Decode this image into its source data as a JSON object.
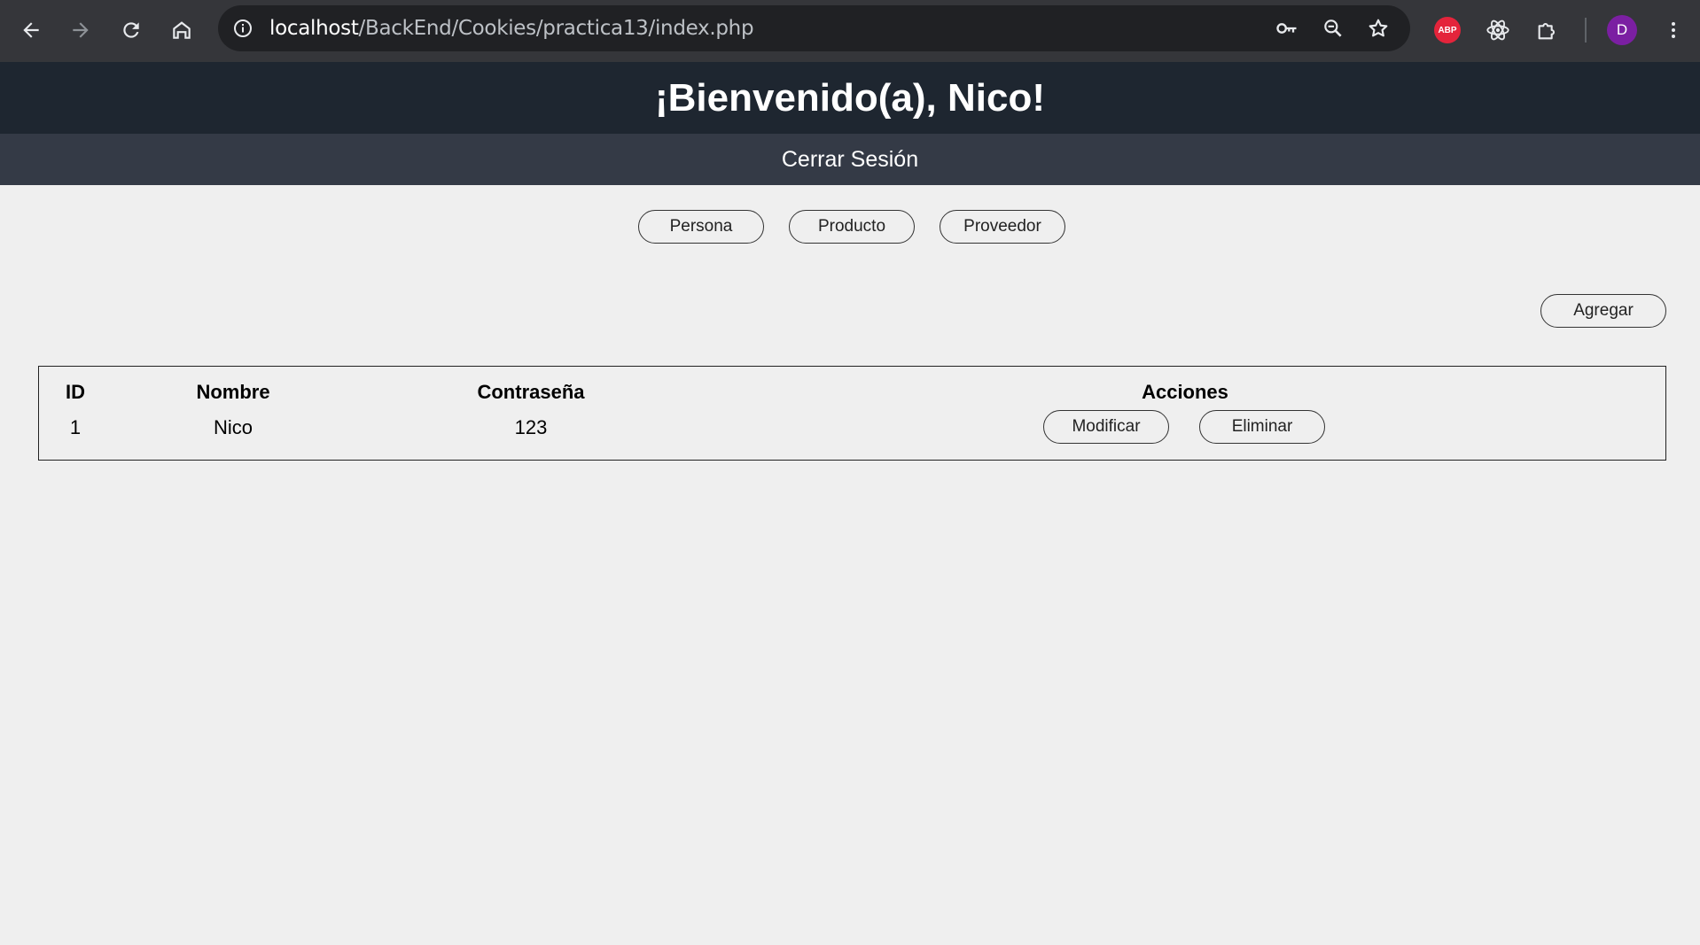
{
  "browser": {
    "url_host": "localhost",
    "url_path": "/BackEnd/Cookies/practica13/index.php",
    "icons": {
      "back": "arrow-left-icon",
      "forward": "arrow-right-icon",
      "reload": "reload-icon",
      "home": "home-icon",
      "info": "info-icon",
      "password": "key-icon",
      "zoom": "zoom-icon",
      "bookmark": "star-icon",
      "react_devtools": "atom-icon",
      "extensions": "puzzle-icon",
      "menu": "kebab-menu-icon"
    },
    "abp_label": "ABP",
    "profile_initial": "D",
    "colors": {
      "abp": "#e4243b",
      "profile": "#7b1fa2"
    }
  },
  "page": {
    "welcome": "¡Bienvenido(a), Nico!",
    "logout": "Cerrar Sesión",
    "nav": [
      "Persona",
      "Producto",
      "Proveedor"
    ],
    "add_button": "Agregar",
    "colors": {
      "header_bg": "#1e2630",
      "subnav_bg": "#343a46",
      "page_bg": "#efefef"
    }
  },
  "table": {
    "headers": [
      "ID",
      "Nombre",
      "Contraseña",
      "Acciones"
    ],
    "rows": [
      {
        "id": "1",
        "nombre": "Nico",
        "contrasena": "123",
        "edit": "Modificar",
        "delete": "Eliminar"
      }
    ]
  }
}
